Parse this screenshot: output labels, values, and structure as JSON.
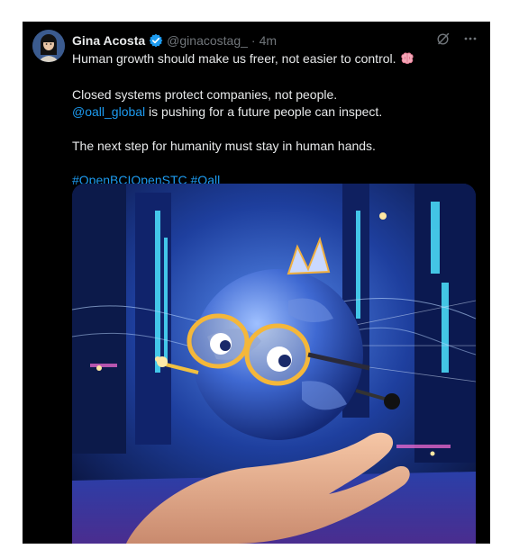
{
  "tweet": {
    "display_name": "Gina Acosta",
    "handle": "@ginacostag_",
    "separator": "·",
    "time": "4m",
    "verified": true,
    "lines": {
      "l1": "Human growth should make us freer, not easier to control.",
      "l2": "Closed systems protect companies, not people.",
      "mention": "@oall_global",
      "l3_rest": " is pushing for a future people can inspect.",
      "l4": "The next step for humanity must stay in human hands.",
      "hashtag1": "#OpenBCIOpenSTC",
      "hashtag2": "#Oall"
    },
    "icons": {
      "avatar": "user-avatar",
      "verified": "verified-badge-icon",
      "grok": "grok-icon",
      "more": "more-icon",
      "brain": "brain-emoji-icon"
    },
    "colors": {
      "background": "#000000",
      "text": "#e7e9ea",
      "muted": "#71767b",
      "link": "#1d9bf0"
    }
  }
}
